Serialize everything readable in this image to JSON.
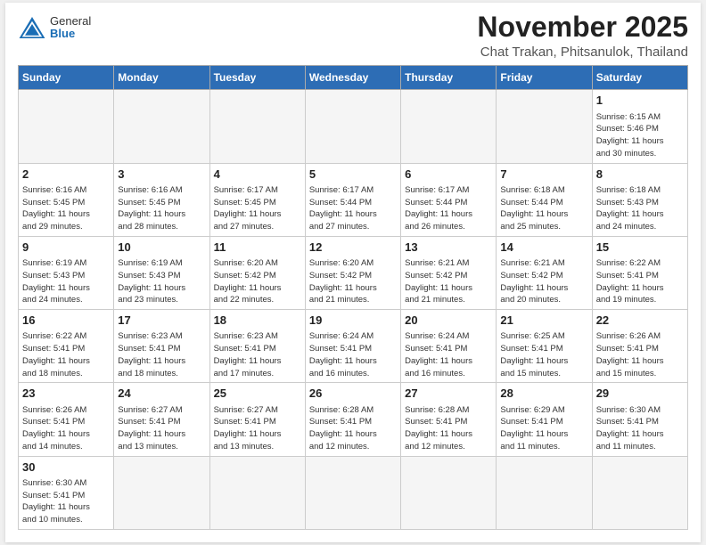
{
  "logo": {
    "text_general": "General",
    "text_blue": "Blue"
  },
  "title": "November 2025",
  "location": "Chat Trakan, Phitsanulok, Thailand",
  "weekdays": [
    "Sunday",
    "Monday",
    "Tuesday",
    "Wednesday",
    "Thursday",
    "Friday",
    "Saturday"
  ],
  "weeks": [
    [
      {
        "day": "",
        "info": ""
      },
      {
        "day": "",
        "info": ""
      },
      {
        "day": "",
        "info": ""
      },
      {
        "day": "",
        "info": ""
      },
      {
        "day": "",
        "info": ""
      },
      {
        "day": "",
        "info": ""
      },
      {
        "day": "1",
        "info": "Sunrise: 6:15 AM\nSunset: 5:46 PM\nDaylight: 11 hours\nand 30 minutes."
      }
    ],
    [
      {
        "day": "2",
        "info": "Sunrise: 6:16 AM\nSunset: 5:45 PM\nDaylight: 11 hours\nand 29 minutes."
      },
      {
        "day": "3",
        "info": "Sunrise: 6:16 AM\nSunset: 5:45 PM\nDaylight: 11 hours\nand 28 minutes."
      },
      {
        "day": "4",
        "info": "Sunrise: 6:17 AM\nSunset: 5:45 PM\nDaylight: 11 hours\nand 27 minutes."
      },
      {
        "day": "5",
        "info": "Sunrise: 6:17 AM\nSunset: 5:44 PM\nDaylight: 11 hours\nand 27 minutes."
      },
      {
        "day": "6",
        "info": "Sunrise: 6:17 AM\nSunset: 5:44 PM\nDaylight: 11 hours\nand 26 minutes."
      },
      {
        "day": "7",
        "info": "Sunrise: 6:18 AM\nSunset: 5:44 PM\nDaylight: 11 hours\nand 25 minutes."
      },
      {
        "day": "8",
        "info": "Sunrise: 6:18 AM\nSunset: 5:43 PM\nDaylight: 11 hours\nand 24 minutes."
      }
    ],
    [
      {
        "day": "9",
        "info": "Sunrise: 6:19 AM\nSunset: 5:43 PM\nDaylight: 11 hours\nand 24 minutes."
      },
      {
        "day": "10",
        "info": "Sunrise: 6:19 AM\nSunset: 5:43 PM\nDaylight: 11 hours\nand 23 minutes."
      },
      {
        "day": "11",
        "info": "Sunrise: 6:20 AM\nSunset: 5:42 PM\nDaylight: 11 hours\nand 22 minutes."
      },
      {
        "day": "12",
        "info": "Sunrise: 6:20 AM\nSunset: 5:42 PM\nDaylight: 11 hours\nand 21 minutes."
      },
      {
        "day": "13",
        "info": "Sunrise: 6:21 AM\nSunset: 5:42 PM\nDaylight: 11 hours\nand 21 minutes."
      },
      {
        "day": "14",
        "info": "Sunrise: 6:21 AM\nSunset: 5:42 PM\nDaylight: 11 hours\nand 20 minutes."
      },
      {
        "day": "15",
        "info": "Sunrise: 6:22 AM\nSunset: 5:41 PM\nDaylight: 11 hours\nand 19 minutes."
      }
    ],
    [
      {
        "day": "16",
        "info": "Sunrise: 6:22 AM\nSunset: 5:41 PM\nDaylight: 11 hours\nand 18 minutes."
      },
      {
        "day": "17",
        "info": "Sunrise: 6:23 AM\nSunset: 5:41 PM\nDaylight: 11 hours\nand 18 minutes."
      },
      {
        "day": "18",
        "info": "Sunrise: 6:23 AM\nSunset: 5:41 PM\nDaylight: 11 hours\nand 17 minutes."
      },
      {
        "day": "19",
        "info": "Sunrise: 6:24 AM\nSunset: 5:41 PM\nDaylight: 11 hours\nand 16 minutes."
      },
      {
        "day": "20",
        "info": "Sunrise: 6:24 AM\nSunset: 5:41 PM\nDaylight: 11 hours\nand 16 minutes."
      },
      {
        "day": "21",
        "info": "Sunrise: 6:25 AM\nSunset: 5:41 PM\nDaylight: 11 hours\nand 15 minutes."
      },
      {
        "day": "22",
        "info": "Sunrise: 6:26 AM\nSunset: 5:41 PM\nDaylight: 11 hours\nand 15 minutes."
      }
    ],
    [
      {
        "day": "23",
        "info": "Sunrise: 6:26 AM\nSunset: 5:41 PM\nDaylight: 11 hours\nand 14 minutes."
      },
      {
        "day": "24",
        "info": "Sunrise: 6:27 AM\nSunset: 5:41 PM\nDaylight: 11 hours\nand 13 minutes."
      },
      {
        "day": "25",
        "info": "Sunrise: 6:27 AM\nSunset: 5:41 PM\nDaylight: 11 hours\nand 13 minutes."
      },
      {
        "day": "26",
        "info": "Sunrise: 6:28 AM\nSunset: 5:41 PM\nDaylight: 11 hours\nand 12 minutes."
      },
      {
        "day": "27",
        "info": "Sunrise: 6:28 AM\nSunset: 5:41 PM\nDaylight: 11 hours\nand 12 minutes."
      },
      {
        "day": "28",
        "info": "Sunrise: 6:29 AM\nSunset: 5:41 PM\nDaylight: 11 hours\nand 11 minutes."
      },
      {
        "day": "29",
        "info": "Sunrise: 6:30 AM\nSunset: 5:41 PM\nDaylight: 11 hours\nand 11 minutes."
      }
    ],
    [
      {
        "day": "30",
        "info": "Sunrise: 6:30 AM\nSunset: 5:41 PM\nDaylight: 11 hours\nand 10 minutes."
      },
      {
        "day": "",
        "info": ""
      },
      {
        "day": "",
        "info": ""
      },
      {
        "day": "",
        "info": ""
      },
      {
        "day": "",
        "info": ""
      },
      {
        "day": "",
        "info": ""
      },
      {
        "day": "",
        "info": ""
      }
    ]
  ]
}
